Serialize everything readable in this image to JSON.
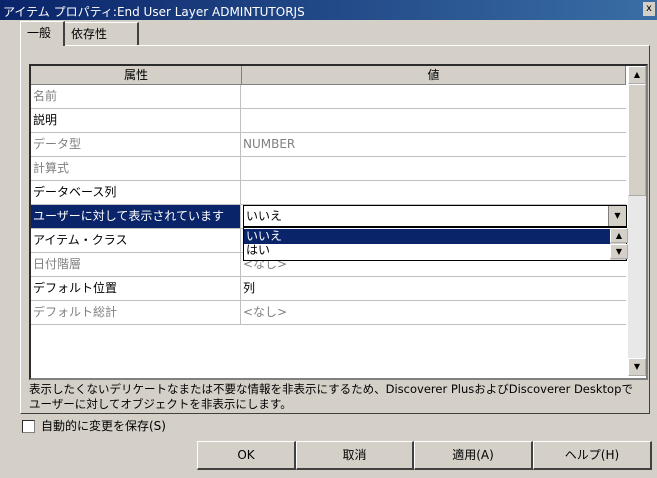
{
  "window": {
    "title": "アイテム プロパティ:End User Layer  ADMINTUTORJS",
    "close_glyph": "x"
  },
  "tabs": [
    {
      "label": "一般"
    },
    {
      "label": "依存性"
    }
  ],
  "grid": {
    "headers": [
      "属性",
      "値"
    ],
    "rows": [
      {
        "name": "名前",
        "value": ""
      },
      {
        "name": "説明",
        "value": ""
      },
      {
        "name": "データ型",
        "value": "NUMBER"
      },
      {
        "name": "計算式",
        "value": ""
      },
      {
        "name": "データベース列",
        "value": ""
      },
      {
        "name": "ユーザーに対して表示されています",
        "value": "いいえ"
      },
      {
        "name": "アイテム・クラス",
        "value": ""
      },
      {
        "name": "日付階層",
        "value": "<なし>"
      },
      {
        "name": "デフォルト位置",
        "value": "列"
      },
      {
        "name": "デフォルト総計",
        "value": "<なし>"
      }
    ],
    "dropdown_options": [
      "いいえ",
      "はい"
    ]
  },
  "description": "表示したくないデリケートなまたは不要な情報を非表示にするため、Discoverer PlusおよびDiscoverer Desktopでユーザーに対してオブジェクトを非表示にします。",
  "autosave": {
    "label": "自動的に変更を保存(S)",
    "checked": false
  },
  "buttons": {
    "ok": "OK",
    "cancel": "取消",
    "apply": "適用(A)",
    "help": "ヘルプ(H)"
  }
}
